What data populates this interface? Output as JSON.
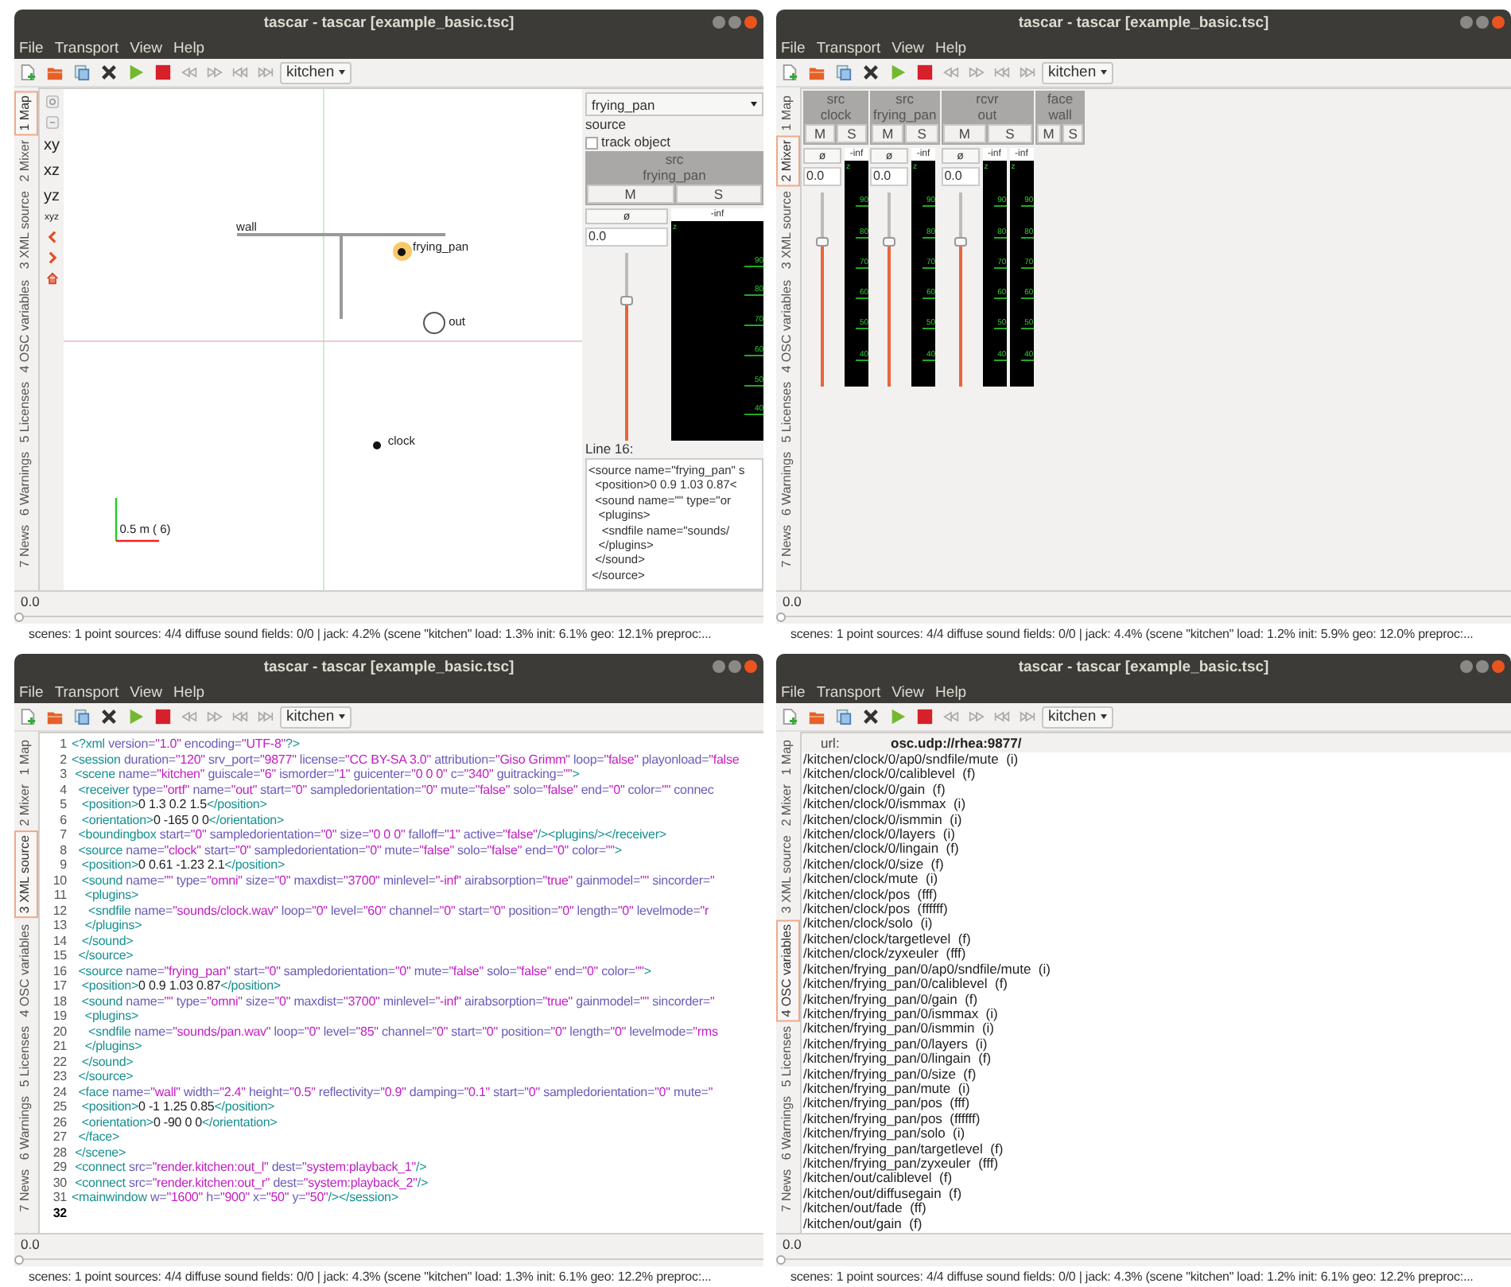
{
  "windows": [
    {
      "title": "tascar - tascar [example_basic.tsc]",
      "menu": [
        "File",
        "Transport",
        "View",
        "Help"
      ],
      "scene": "kitchen",
      "tabs": [
        {
          "label": "1 Map",
          "selected": true
        },
        {
          "label": "2 Mixer",
          "selected": false
        },
        {
          "label": "3 XML source",
          "selected": false
        },
        {
          "label": "4 OSC variables",
          "selected": false
        },
        {
          "label": "5 Licenses",
          "selected": false
        },
        {
          "label": "6 Warnings",
          "selected": false
        },
        {
          "label": "7 News",
          "selected": false
        }
      ],
      "view": {
        "kind": "map",
        "view_buttons": [
          "xy",
          "xz",
          "yz",
          "xyz"
        ],
        "objects": [
          {
            "kind": "face",
            "label": "wall",
            "selected": false
          },
          {
            "kind": "source",
            "label": "frying_pan",
            "selected": true
          },
          {
            "kind": "receiver",
            "label": "out",
            "selected": false
          },
          {
            "kind": "source",
            "label": "clock",
            "selected": false
          }
        ],
        "scale": "0.5 m ( 6)",
        "panel": {
          "object": "frying_pan",
          "type": "source",
          "track_label": "track object",
          "track_checked": false,
          "strip": {
            "kind": "source",
            "tag": "src",
            "name": "frying_pan",
            "mute": "M",
            "solo": "S",
            "phase": "ø",
            "value": "0.0",
            "level": 0.75,
            "meters": [
              {
                "reading": "-inf",
                "top": "z",
                "ticks": [
                  "90",
                  "80",
                  "70",
                  "60",
                  "50",
                  "40"
                ]
              }
            ]
          },
          "line_label": "Line 16:",
          "code": [
            "<source name=\"frying_pan\" s",
            "  <position>0 0.9 1.03 0.87<",
            "  <sound name=\"\" type=\"or",
            "   <plugins>",
            "    <sndfile name=\"sounds/",
            "   </plugins>",
            "  </sound>",
            " </source>"
          ]
        }
      },
      "timeline": {
        "time": "0.0",
        "level": 0
      },
      "status": "scenes: 1  point sources: 4/4  diffuse sound fields: 0/0 | jack: 4.2% (scene \"kitchen\" load: 1.3% init: 6.1%  geo: 12.1%  preproc:..."
    },
    {
      "title": "tascar - tascar [example_basic.tsc]",
      "menu": [
        "File",
        "Transport",
        "View",
        "Help"
      ],
      "scene": "kitchen",
      "tabs": [
        {
          "label": "1 Map",
          "selected": false
        },
        {
          "label": "2 Mixer",
          "selected": true
        },
        {
          "label": "3 XML source",
          "selected": false
        },
        {
          "label": "4 OSC variables",
          "selected": false
        },
        {
          "label": "5 Licenses",
          "selected": false
        },
        {
          "label": "6 Warnings",
          "selected": false
        },
        {
          "label": "7 News",
          "selected": false
        }
      ],
      "view": {
        "kind": "mixer",
        "strips": [
          {
            "kind": "source",
            "tag": "src",
            "name": "clock",
            "mute": "M",
            "solo": "S",
            "phase": "ø",
            "value": "0.0",
            "level": 0.75,
            "meters": [
              {
                "reading": "-inf",
                "top": "z",
                "ticks": [
                  "90",
                  "80",
                  "70",
                  "60",
                  "50",
                  "40"
                ]
              }
            ]
          },
          {
            "kind": "source",
            "tag": "src",
            "name": "frying_pan",
            "mute": "M",
            "solo": "S",
            "phase": "ø",
            "value": "0.0",
            "level": 0.75,
            "meters": [
              {
                "reading": "-inf",
                "top": "z",
                "ticks": [
                  "90",
                  "80",
                  "70",
                  "60",
                  "50",
                  "40"
                ]
              }
            ]
          },
          {
            "kind": "receiver",
            "tag": "rcvr",
            "name": "out",
            "mute": "M",
            "solo": "S",
            "phase": "ø",
            "value": "0.0",
            "level": 0.75,
            "meters": [
              {
                "reading": "-inf",
                "top": "z",
                "ticks": [
                  "90",
                  "80",
                  "70",
                  "60",
                  "50",
                  "40"
                ]
              },
              {
                "reading": "-inf",
                "top": "z",
                "ticks": [
                  "90",
                  "80",
                  "70",
                  "60",
                  "50",
                  "40"
                ]
              }
            ]
          },
          {
            "kind": "face",
            "tag": "face",
            "name": "wall",
            "mute": "M",
            "solo": "S"
          }
        ]
      },
      "timeline": {
        "time": "0.0",
        "level": 0
      },
      "status": "scenes: 1  point sources: 4/4  diffuse sound fields: 0/0 | jack: 4.4% (scene \"kitchen\" load: 1.2% init: 5.9%  geo: 12.0%  preproc:..."
    },
    {
      "title": "tascar - tascar [example_basic.tsc]",
      "menu": [
        "File",
        "Transport",
        "View",
        "Help"
      ],
      "scene": "kitchen",
      "tabs": [
        {
          "label": "1 Map",
          "selected": false
        },
        {
          "label": "2 Mixer",
          "selected": false
        },
        {
          "label": "3 XML source",
          "selected": true
        },
        {
          "label": "4 OSC variables",
          "selected": false
        },
        {
          "label": "5 Licenses",
          "selected": false
        },
        {
          "label": "6 Warnings",
          "selected": false
        },
        {
          "label": "7 News",
          "selected": false
        }
      ],
      "view": {
        "kind": "xml",
        "lines": [
          {
            "n": "1",
            "text": "<?xml version=\"1.0\" encoding=\"UTF-8\"?>",
            "current": false
          },
          {
            "n": "2",
            "text": "<session duration=\"120\" srv_port=\"9877\" license=\"CC BY-SA 3.0\" attribution=\"Giso Grimm\" loop=\"false\" playonload=\"false",
            "current": false
          },
          {
            "n": "3",
            "text": " <scene name=\"kitchen\" guiscale=\"6\" ismorder=\"1\" guicenter=\"0 0 0\" c=\"340\" guitracking=\"\">",
            "current": false
          },
          {
            "n": "4",
            "text": "  <receiver type=\"ortf\" name=\"out\" start=\"0\" sampledorientation=\"0\" mute=\"false\" solo=\"false\" end=\"0\" color=\"\" connec",
            "current": false
          },
          {
            "n": "5",
            "text": "   <position>0 1.3 0.2 1.5</position>",
            "current": false
          },
          {
            "n": "6",
            "text": "   <orientation>0 -165 0 0</orientation>",
            "current": false
          },
          {
            "n": "7",
            "text": "  <boundingbox start=\"0\" sampledorientation=\"0\" size=\"0 0 0\" falloff=\"1\" active=\"false\"/><plugins/></receiver>",
            "current": false
          },
          {
            "n": "8",
            "text": "  <source name=\"clock\" start=\"0\" sampledorientation=\"0\" mute=\"false\" solo=\"false\" end=\"0\" color=\"\">",
            "current": false
          },
          {
            "n": "9",
            "text": "   <position>0 0.61 -1.23 2.1</position>",
            "current": false
          },
          {
            "n": "10",
            "text": "   <sound name=\"\" type=\"omni\" size=\"0\" maxdist=\"3700\" minlevel=\"-inf\" airabsorption=\"true\" gainmodel=\"\" sincorder=\"",
            "current": false
          },
          {
            "n": "11",
            "text": "    <plugins>",
            "current": false
          },
          {
            "n": "12",
            "text": "     <sndfile name=\"sounds/clock.wav\" loop=\"0\" level=\"60\" channel=\"0\" start=\"0\" position=\"0\" length=\"0\" levelmode=\"r",
            "current": false
          },
          {
            "n": "13",
            "text": "    </plugins>",
            "current": false
          },
          {
            "n": "14",
            "text": "   </sound>",
            "current": false
          },
          {
            "n": "15",
            "text": "  </source>",
            "current": false
          },
          {
            "n": "16",
            "text": "  <source name=\"frying_pan\" start=\"0\" sampledorientation=\"0\" mute=\"false\" solo=\"false\" end=\"0\" color=\"\">",
            "current": false
          },
          {
            "n": "17",
            "text": "   <position>0 0.9 1.03 0.87</position>",
            "current": false
          },
          {
            "n": "18",
            "text": "   <sound name=\"\" type=\"omni\" size=\"0\" maxdist=\"3700\" minlevel=\"-inf\" airabsorption=\"true\" gainmodel=\"\" sincorder=\"",
            "current": false
          },
          {
            "n": "19",
            "text": "    <plugins>",
            "current": false
          },
          {
            "n": "20",
            "text": "     <sndfile name=\"sounds/pan.wav\" loop=\"0\" level=\"85\" channel=\"0\" start=\"0\" position=\"0\" length=\"0\" levelmode=\"rms",
            "current": false
          },
          {
            "n": "21",
            "text": "    </plugins>",
            "current": false
          },
          {
            "n": "22",
            "text": "   </sound>",
            "current": false
          },
          {
            "n": "23",
            "text": "  </source>",
            "current": false
          },
          {
            "n": "24",
            "text": "  <face name=\"wall\" width=\"2.4\" height=\"0.5\" reflectivity=\"0.9\" damping=\"0.1\" start=\"0\" sampledorientation=\"0\" mute=\"",
            "current": false
          },
          {
            "n": "25",
            "text": "   <position>0 -1 1.25 0.85</position>",
            "current": false
          },
          {
            "n": "26",
            "text": "   <orientation>0 -90 0 0</orientation>",
            "current": false
          },
          {
            "n": "27",
            "text": "  </face>",
            "current": false
          },
          {
            "n": "28",
            "text": " </scene>",
            "current": false
          },
          {
            "n": "29",
            "text": " <connect src=\"render.kitchen:out_l\" dest=\"system:playback_1\"/>",
            "current": false
          },
          {
            "n": "30",
            "text": " <connect src=\"render.kitchen:out_r\" dest=\"system:playback_2\"/>",
            "current": false
          },
          {
            "n": "31",
            "text": "<mainwindow w=\"1600\" h=\"900\" x=\"50\" y=\"50\"/></session>",
            "current": false
          },
          {
            "n": "32",
            "current": true
          }
        ]
      },
      "timeline": {
        "time": "0.0",
        "level": 0
      },
      "status": "scenes: 1  point sources: 4/4  diffuse sound fields: 0/0 | jack: 4.3% (scene \"kitchen\" load: 1.3% init: 6.1%  geo: 12.2%  preproc:..."
    },
    {
      "title": "tascar - tascar [example_basic.tsc]",
      "menu": [
        "File",
        "Transport",
        "View",
        "Help"
      ],
      "scene": "kitchen",
      "tabs": [
        {
          "label": "1 Map",
          "selected": false
        },
        {
          "label": "2 Mixer",
          "selected": false
        },
        {
          "label": "3 XML source",
          "selected": false
        },
        {
          "label": "4 OSC variables",
          "selected": true
        },
        {
          "label": "5 Licenses",
          "selected": false
        },
        {
          "label": "6 Warnings",
          "selected": false
        },
        {
          "label": "7 News",
          "selected": false
        }
      ],
      "view": {
        "kind": "osc",
        "url_label": "url:",
        "url": "osc.udp://rhea:9877/",
        "variables": [
          "/kitchen/clock/0/ap0/sndfile/mute  (i)",
          "/kitchen/clock/0/caliblevel  (f)",
          "/kitchen/clock/0/gain  (f)",
          "/kitchen/clock/0/ismmax  (i)",
          "/kitchen/clock/0/ismmin  (i)",
          "/kitchen/clock/0/layers  (i)",
          "/kitchen/clock/0/lingain  (f)",
          "/kitchen/clock/0/size  (f)",
          "/kitchen/clock/mute  (i)",
          "/kitchen/clock/pos  (fff)",
          "/kitchen/clock/pos  (ffffff)",
          "/kitchen/clock/solo  (i)",
          "/kitchen/clock/targetlevel  (f)",
          "/kitchen/clock/zyxeuler  (fff)",
          "/kitchen/frying_pan/0/ap0/sndfile/mute  (i)",
          "/kitchen/frying_pan/0/caliblevel  (f)",
          "/kitchen/frying_pan/0/gain  (f)",
          "/kitchen/frying_pan/0/ismmax  (i)",
          "/kitchen/frying_pan/0/ismmin  (i)",
          "/kitchen/frying_pan/0/layers  (i)",
          "/kitchen/frying_pan/0/lingain  (f)",
          "/kitchen/frying_pan/0/size  (f)",
          "/kitchen/frying_pan/mute  (i)",
          "/kitchen/frying_pan/pos  (fff)",
          "/kitchen/frying_pan/pos  (ffffff)",
          "/kitchen/frying_pan/solo  (i)",
          "/kitchen/frying_pan/targetlevel  (f)",
          "/kitchen/frying_pan/zyxeuler  (fff)",
          "/kitchen/out/caliblevel  (f)",
          "/kitchen/out/diffusegain  (f)",
          "/kitchen/out/fade  (ff)",
          "/kitchen/out/gain  (f)"
        ]
      },
      "timeline": {
        "time": "0.0",
        "level": 0
      },
      "status": "scenes: 1  point sources: 4/4  diffuse sound fields: 0/0 | jack: 4.3% (scene \"kitchen\" load: 1.2% init: 6.1%  geo: 12.2%  preproc:..."
    }
  ]
}
